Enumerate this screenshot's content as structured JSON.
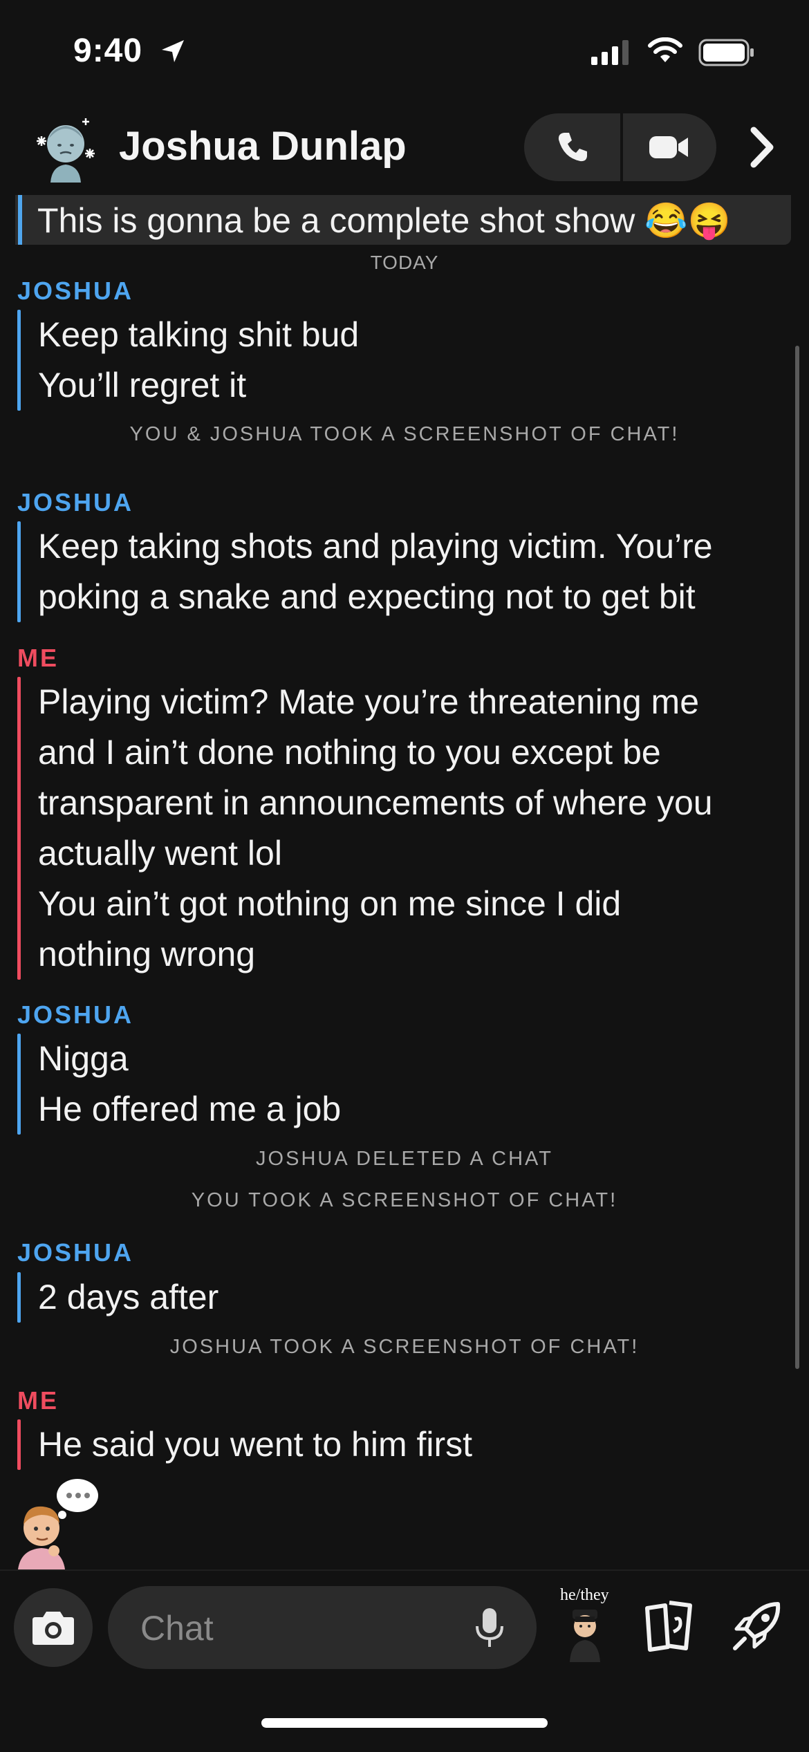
{
  "status_bar": {
    "time": "9:40"
  },
  "header": {
    "contact_name": "Joshua Dunlap"
  },
  "saved_message": {
    "text": "This is gonna be a complete shot show 😂😝"
  },
  "date_separator": "TODAY",
  "messages": [
    {
      "sender": "JOSHUA",
      "lines": [
        "Keep talking shit bud",
        "You’ll regret it"
      ]
    },
    {
      "sender": "JOSHUA",
      "lines": [
        "Keep taking shots and playing victim. You’re",
        "poking a snake and expecting not to get bit"
      ]
    },
    {
      "sender": "ME",
      "lines": [
        "Playing victim? Mate you’re threatening me",
        "and I ain’t done nothing to you except be",
        "transparent in announcements of where you",
        "actually went lol",
        "You ain’t got nothing on me since I did",
        "nothing wrong"
      ]
    },
    {
      "sender": "JOSHUA",
      "lines": [
        "Nigga",
        "He offered me a job"
      ]
    },
    {
      "sender": "JOSHUA",
      "lines": [
        "2 days after"
      ]
    },
    {
      "sender": "ME",
      "lines": [
        "He said you went to him first"
      ]
    }
  ],
  "system_notices": [
    "YOU & JOSHUA TOOK A SCREENSHOT OF CHAT!",
    "JOSHUA DELETED A CHAT",
    "YOU TOOK A SCREENSHOT OF CHAT!",
    "JOSHUA TOOK A SCREENSHOT OF CHAT!"
  ],
  "composer": {
    "placeholder": "Chat",
    "pronoun_tag": "he/they"
  },
  "colors": {
    "joshua": "#4ea5f0",
    "me": "#ef4c5f",
    "background": "#121212"
  },
  "icons": [
    "location-arrow-icon",
    "signal-icon",
    "wifi-icon",
    "battery-icon",
    "phone-icon",
    "video-icon",
    "chevron-right-icon",
    "camera-icon",
    "microphone-icon",
    "cards-icon",
    "rocket-icon",
    "typing-bubble-icon"
  ]
}
